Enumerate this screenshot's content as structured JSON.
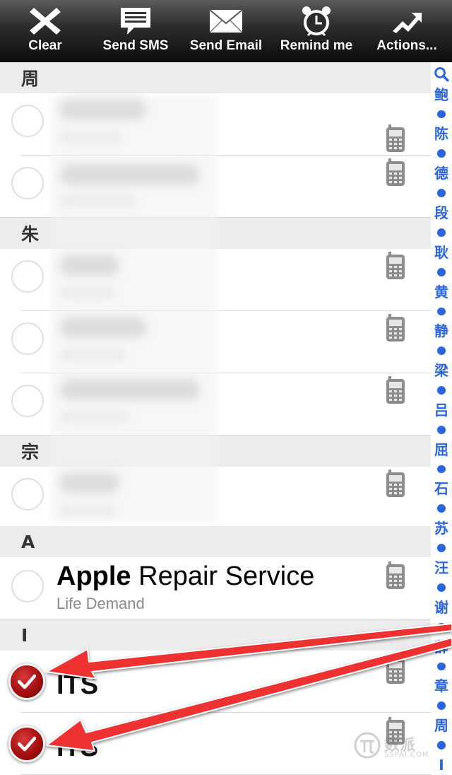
{
  "toolbar": {
    "buttons": [
      {
        "label": "Clear",
        "icon": "x-icon"
      },
      {
        "label": "Send SMS",
        "icon": "speech-bubble-icon"
      },
      {
        "label": "Send Email",
        "icon": "envelope-icon"
      },
      {
        "label": "Remind me",
        "icon": "alarm-clock-icon"
      },
      {
        "label": "Actions...",
        "icon": "arrow-up-right-icon"
      }
    ]
  },
  "sections": [
    {
      "header": "周"
    },
    {
      "header": "朱"
    },
    {
      "header": "宗"
    },
    {
      "header": "A"
    },
    {
      "header": "I"
    }
  ],
  "contacts": {
    "apple": {
      "name_bold": "Apple",
      "name_rest": " Repair Service",
      "subtitle": "Life Demand",
      "selected": false
    },
    "its_1": {
      "name": "ITS",
      "selected": true
    },
    "its_2": {
      "name": "ITS",
      "selected": true
    }
  },
  "index_bar": [
    "鲍",
    "陈",
    "德",
    "段",
    "耿",
    "黄",
    "静",
    "梁",
    "吕",
    "屈",
    "石",
    "苏",
    "汪",
    "谢",
    "薛",
    "章",
    "周",
    "I"
  ],
  "watermark": {
    "text": "数派",
    "sub": "SSPAI.COM"
  },
  "colors": {
    "index_blue": "#2a64e0",
    "annotation_arrow": "#ee3333",
    "check_red": "#a30f0f"
  }
}
